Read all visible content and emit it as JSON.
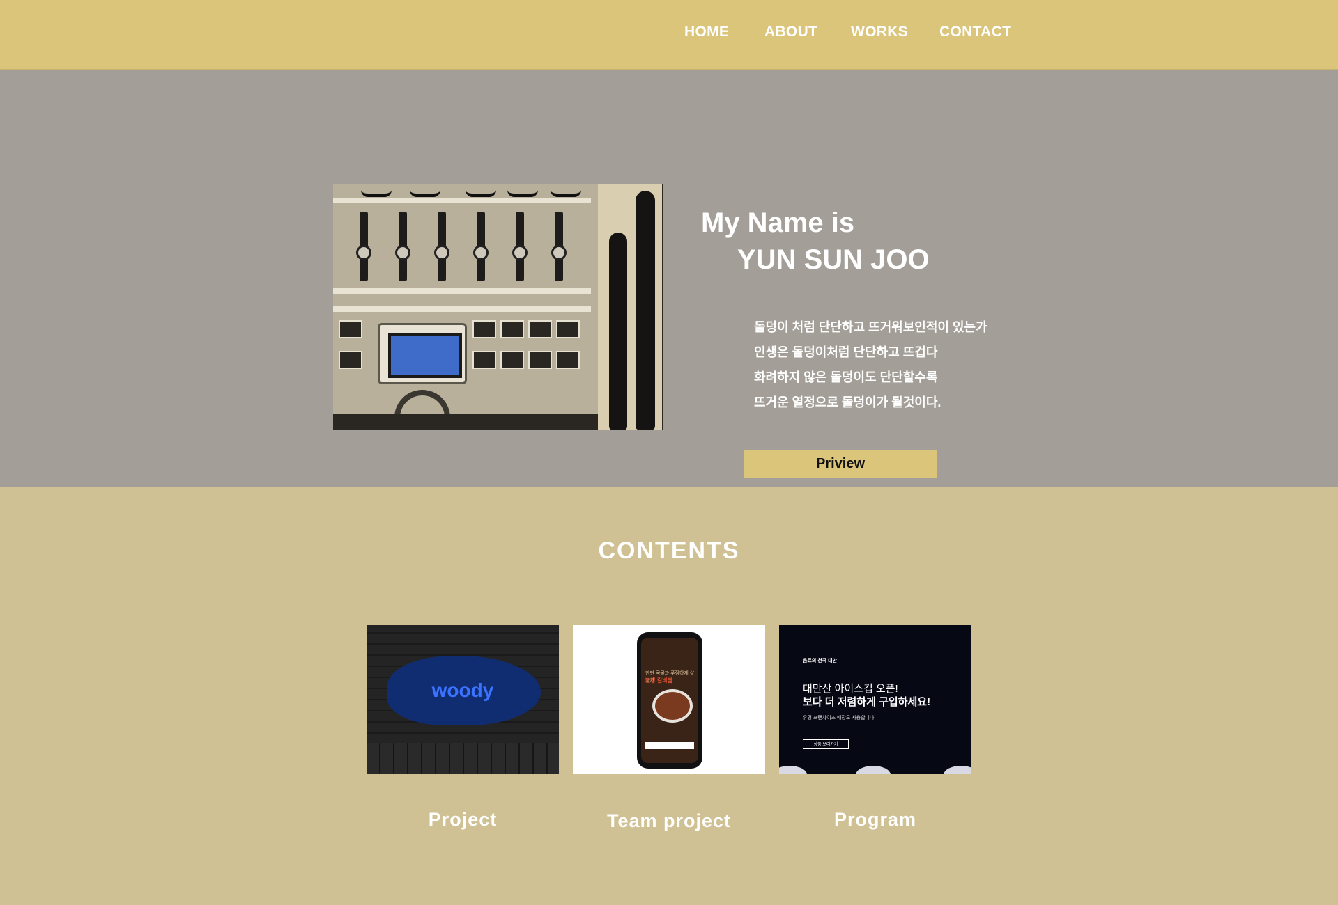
{
  "nav": {
    "items": [
      "HOME",
      "ABOUT",
      "WORKS",
      "CONTACT"
    ]
  },
  "hero": {
    "intro": "My Name is",
    "name": "YUN SUN JOO",
    "bio": [
      "돌덩이 처럼 단단하고 뜨거워보인적이 있는가",
      "인생은 돌덩이처럼 단단하고 뜨겁다",
      "화려하지 않은 돌덩이도 단단할수록",
      "뜨거운 열정으로 돌덩이가 될것이다."
    ],
    "button": "Priview"
  },
  "contents": {
    "title": "CONTENTS",
    "cards": [
      {
        "label": "Project",
        "thumb_text": "woody"
      },
      {
        "label": "Team project",
        "thumb_title": "한판 국물과 푸짐하게 살코기",
        "thumb_title2": "한방 갈비찜"
      },
      {
        "label": "Program",
        "thumb_tag": "음료의 천국 대만",
        "thumb_h1": "대만산 아이스컵 오픈!",
        "thumb_h2": "보다 더 저렴하게 구입하세요!",
        "thumb_sub": "유명 프랜차이즈 매장도 사용합니다",
        "thumb_btn": "상품 보러가기"
      }
    ]
  },
  "colors": {
    "header": "#dbc57b",
    "hero_bg": "#a39f98",
    "contents_bg": "#cfc194",
    "button": "#dbc57b"
  }
}
